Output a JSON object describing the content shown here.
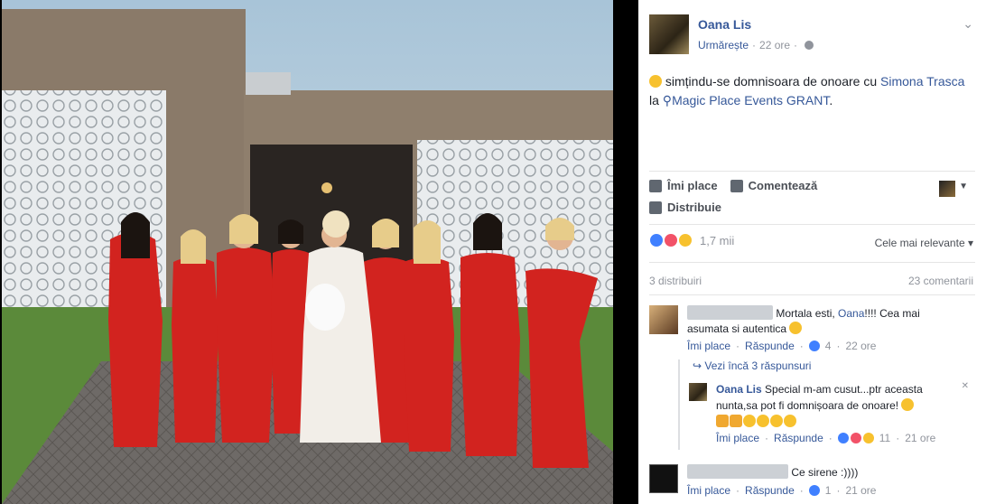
{
  "post": {
    "author": "Oana Lis",
    "follow_label": "Urmărește",
    "time": "22 ore",
    "status_prefix": "simțindu-se domnisoara de onoare cu",
    "tagged": "Simona Trasca",
    "at_word": "la",
    "place": "Magic Place Events GRANT",
    "period": "."
  },
  "actions": {
    "like": "Îmi place",
    "comment": "Comentează",
    "share": "Distribuie"
  },
  "reactions": {
    "count": "1,7 mii",
    "sort_label": "Cele mai relevante"
  },
  "stats": {
    "shares": "3 distribuiri",
    "comments": "23 comentarii"
  },
  "comments": [
    {
      "text_start": "Mortala esti, ",
      "mention": "Oana",
      "text_end": "!!!! Cea mai asumata si autentica",
      "like": "Îmi place",
      "reply": "Răspunde",
      "reactions": "4",
      "time": "22 ore"
    },
    {
      "text": "Ce sirene :))))",
      "like": "Îmi place",
      "reply": "Răspunde",
      "reactions": "1",
      "time": "21 ore"
    }
  ],
  "more_replies": "Vezi încă 3 răspunsuri",
  "reply": {
    "author": "Oana Lis",
    "text": "Special m-am cusut...ptr aceasta nunta,sa pot fi domnișoara de onoare!",
    "like": "Îmi place",
    "reply": "Răspunde",
    "reactions": "11",
    "time": "21 ore"
  },
  "icons": {
    "like": "thumbs-up-icon",
    "comment": "comment-bubble-icon",
    "share": "share-arrow-icon",
    "privacy": "globe-icon",
    "place": "map-pin-icon",
    "feeling": "smile-emoji-icon",
    "menu": "chevron-down-icon"
  },
  "colors": {
    "link": "#365899",
    "text": "#1d2129",
    "muted": "#90949c",
    "photo_bg": "#000000"
  }
}
